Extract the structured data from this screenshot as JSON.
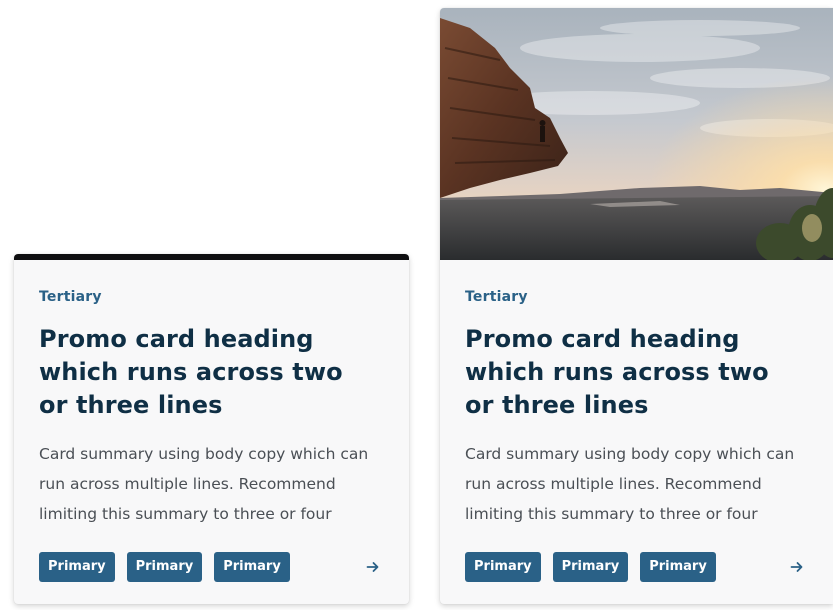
{
  "cards": [
    {
      "tertiary": "Tertiary",
      "heading": "Promo card heading which runs across two or three lines",
      "summary": "Card summary using body copy which can run across multiple lines. Recommend limiting this summary to three or four",
      "tags": [
        "Primary",
        "Primary",
        "Primary"
      ],
      "arrow_icon": "arrow-right-icon"
    },
    {
      "image": "cliff-landscape-sunset",
      "tertiary": "Tertiary",
      "heading": "Promo card heading which runs across two or three lines",
      "summary": "Card summary using body copy which can run across multiple lines. Recommend limiting this summary to three or four",
      "tags": [
        "Primary",
        "Primary",
        "Primary"
      ],
      "arrow_icon": "arrow-right-icon"
    }
  ],
  "colors": {
    "accent": "#2a6187",
    "heading": "#0f2f45",
    "body": "#4a4f55",
    "card_bg": "#f8f8f9",
    "top_bar": "#0e0e10"
  }
}
